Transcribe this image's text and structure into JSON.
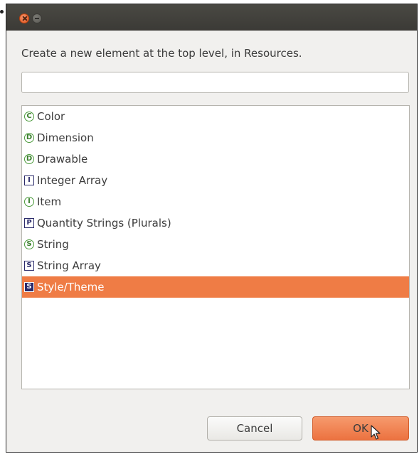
{
  "dialog": {
    "description": "Create a new element at the top level, in Resources.",
    "search": {
      "value": "",
      "placeholder": ""
    }
  },
  "items": [
    {
      "label": "Color",
      "icon_letter": "C",
      "icon": "color-icon",
      "style": "circle",
      "selected": false
    },
    {
      "label": "Dimension",
      "icon_letter": "D",
      "icon": "dimension-icon",
      "style": "circle",
      "selected": false
    },
    {
      "label": "Drawable",
      "icon_letter": "D",
      "icon": "drawable-icon",
      "style": "circle",
      "selected": false
    },
    {
      "label": "Integer Array",
      "icon_letter": "I",
      "icon": "integer-array-icon",
      "style": "square",
      "selected": false
    },
    {
      "label": "Item",
      "icon_letter": "I",
      "icon": "item-icon",
      "style": "circle",
      "selected": false
    },
    {
      "label": "Quantity Strings (Plurals)",
      "icon_letter": "P",
      "icon": "plurals-icon",
      "style": "square",
      "selected": false
    },
    {
      "label": "String",
      "icon_letter": "S",
      "icon": "string-icon",
      "style": "circle",
      "selected": false
    },
    {
      "label": "String Array",
      "icon_letter": "S",
      "icon": "string-array-icon",
      "style": "square",
      "selected": false
    },
    {
      "label": "Style/Theme",
      "icon_letter": "S",
      "icon": "style-theme-icon",
      "style": "square",
      "selected": true
    }
  ],
  "buttons": {
    "cancel": "Cancel",
    "ok": "OK"
  },
  "colors": {
    "selection": "#ef7c45",
    "ok_button": "#f08a5a",
    "titlebar": "#45443f"
  }
}
